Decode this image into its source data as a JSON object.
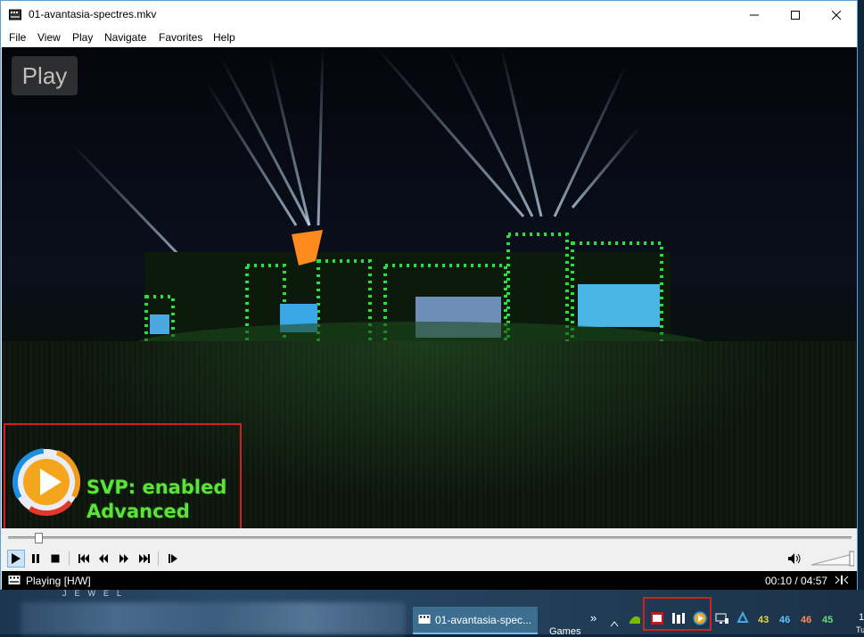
{
  "window": {
    "title": "01-avantasia-spectres.mkv",
    "menu": [
      "File",
      "View",
      "Play",
      "Navigate",
      "Favorites",
      "Help"
    ]
  },
  "video": {
    "osd_label": "Play",
    "svp_line1": "SVP: enabled",
    "svp_line2": "Advanced"
  },
  "playback": {
    "position_fraction": 0.035,
    "volume_fraction": 1.0
  },
  "status": {
    "text": "Playing [H/W]",
    "time": "00:10 / 04:57"
  },
  "desktop": {
    "watermark": "JEWEL"
  },
  "taskbar": {
    "active_app_label": "01-avantasia-spec...",
    "games_label": "Games",
    "chevron": "»",
    "tray_numbers": [
      "43",
      "46",
      "46",
      "45"
    ],
    "tray_number_colors": [
      "#e7d44a",
      "#5ec7ff",
      "#ff8a5c",
      "#6bdc7a"
    ],
    "clock_fragment": "1",
    "clock_fragment2": "Tu"
  },
  "colors": {
    "highlight_red": "#d21f1f",
    "svp_green": "#5fe03a",
    "titlebar_accent": "#5aa0d2"
  }
}
